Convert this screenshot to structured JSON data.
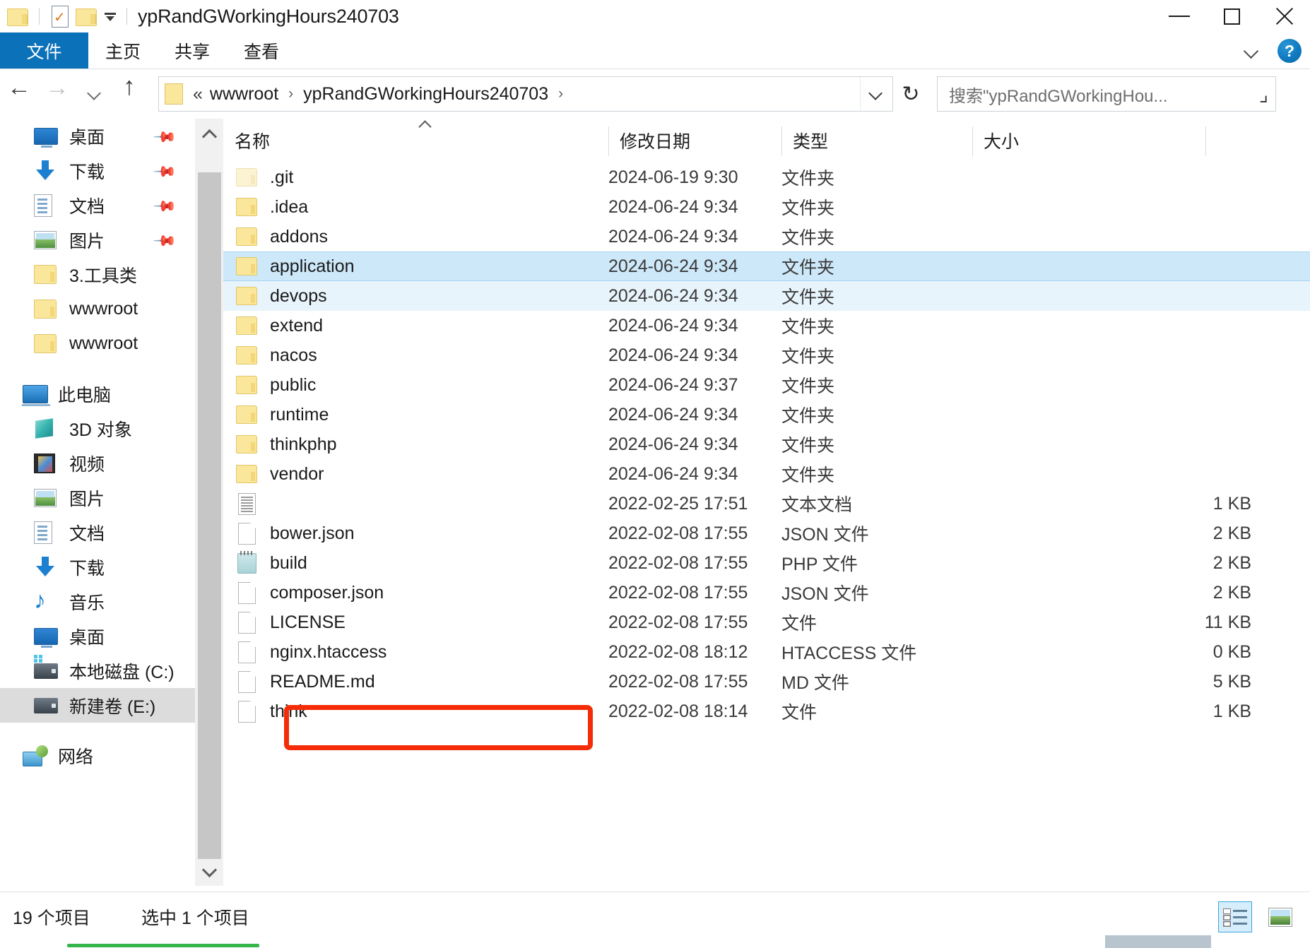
{
  "window": {
    "title": "ypRandGWorkingHours240703",
    "quick_access": [
      "folder-icon",
      "properties-icon",
      "new-folder-icon",
      "customize-dropdown-icon"
    ],
    "controls": {
      "minimize": "minimize-icon",
      "maximize": "maximize-icon",
      "close": "close-icon"
    }
  },
  "ribbon": {
    "tabs": [
      {
        "label": "文件",
        "active": true
      },
      {
        "label": "主页",
        "active": false
      },
      {
        "label": "共享",
        "active": false
      },
      {
        "label": "查看",
        "active": false
      }
    ],
    "collapse_icon": "chevron-down-icon",
    "help_label": "?",
    "accent_color": "#0b71b9"
  },
  "navbar": {
    "back_icon": "arrow-left-icon",
    "forward_icon": "arrow-right-icon",
    "recent_icon": "chevron-down-icon",
    "up_icon": "arrow-up-icon",
    "breadcrumb": {
      "folder_icon": "folder-icon",
      "overflow": "«",
      "items": [
        "wwwroot",
        "ypRandGWorkingHours240703"
      ],
      "separator": "›",
      "dropdown_icon": "chevron-down-icon"
    },
    "refresh_label": "↻",
    "search": {
      "placeholder": "搜索\"ypRandGWorkingHou...",
      "value": "",
      "icon": "search-icon"
    }
  },
  "sidebar": {
    "quick_access": [
      {
        "label": "桌面",
        "icon": "desktop-icon",
        "pinned": true
      },
      {
        "label": "下载",
        "icon": "download-icon",
        "pinned": true
      },
      {
        "label": "文档",
        "icon": "documents-icon",
        "pinned": true
      },
      {
        "label": "图片",
        "icon": "pictures-icon",
        "pinned": true
      },
      {
        "label": "3.工具类",
        "icon": "folder-icon",
        "pinned": false
      },
      {
        "label": "wwwroot",
        "icon": "folder-icon",
        "pinned": false
      },
      {
        "label": "wwwroot",
        "icon": "folder-icon",
        "pinned": false
      }
    ],
    "this_pc": {
      "label": "此电脑",
      "icon": "this-pc-icon"
    },
    "this_pc_children": [
      {
        "label": "3D 对象",
        "icon": "3d-objects-icon",
        "selected": false
      },
      {
        "label": "视频",
        "icon": "videos-icon",
        "selected": false
      },
      {
        "label": "图片",
        "icon": "pictures-icon",
        "selected": false
      },
      {
        "label": "文档",
        "icon": "documents-icon",
        "selected": false
      },
      {
        "label": "下载",
        "icon": "download-icon",
        "selected": false
      },
      {
        "label": "音乐",
        "icon": "music-icon",
        "selected": false
      },
      {
        "label": "桌面",
        "icon": "desktop-icon",
        "selected": false
      },
      {
        "label": "本地磁盘 (C:)",
        "icon": "local-disk-icon",
        "selected": false
      },
      {
        "label": "新建卷 (E:)",
        "icon": "drive-icon",
        "selected": true
      }
    ],
    "network": {
      "label": "网络",
      "icon": "network-icon"
    },
    "scrollbar": {
      "up_icon": "chevron-up-icon",
      "down_icon": "chevron-down-icon"
    }
  },
  "filelist": {
    "columns": [
      {
        "key": "name",
        "label": "名称",
        "sorted": true,
        "sort_icon": "sort-ascending-caret"
      },
      {
        "key": "date",
        "label": "修改日期"
      },
      {
        "key": "type",
        "label": "类型"
      },
      {
        "key": "size",
        "label": "大小"
      }
    ],
    "rows": [
      {
        "name": ".git",
        "date": "2024-06-19 9:30",
        "type": "文件夹",
        "size": "",
        "icon": "folder-icon-dim",
        "state": ""
      },
      {
        "name": ".idea",
        "date": "2024-06-24 9:34",
        "type": "文件夹",
        "size": "",
        "icon": "folder-icon",
        "state": ""
      },
      {
        "name": "addons",
        "date": "2024-06-24 9:34",
        "type": "文件夹",
        "size": "",
        "icon": "folder-icon",
        "state": ""
      },
      {
        "name": "application",
        "date": "2024-06-24 9:34",
        "type": "文件夹",
        "size": "",
        "icon": "folder-icon",
        "state": "selected"
      },
      {
        "name": "devops",
        "date": "2024-06-24 9:34",
        "type": "文件夹",
        "size": "",
        "icon": "folder-icon",
        "state": "hover"
      },
      {
        "name": "extend",
        "date": "2024-06-24 9:34",
        "type": "文件夹",
        "size": "",
        "icon": "folder-icon",
        "state": ""
      },
      {
        "name": "nacos",
        "date": "2024-06-24 9:34",
        "type": "文件夹",
        "size": "",
        "icon": "folder-icon",
        "state": ""
      },
      {
        "name": "public",
        "date": "2024-06-24 9:37",
        "type": "文件夹",
        "size": "",
        "icon": "folder-icon",
        "state": ""
      },
      {
        "name": "runtime",
        "date": "2024-06-24 9:34",
        "type": "文件夹",
        "size": "",
        "icon": "folder-icon",
        "state": ""
      },
      {
        "name": "thinkphp",
        "date": "2024-06-24 9:34",
        "type": "文件夹",
        "size": "",
        "icon": "folder-icon",
        "state": ""
      },
      {
        "name": "vendor",
        "date": "2024-06-24 9:34",
        "type": "文件夹",
        "size": "",
        "icon": "folder-icon",
        "state": ""
      },
      {
        "name": "",
        "date": "2022-02-25 17:51",
        "type": "文本文档",
        "size": "1 KB",
        "icon": "text-document-icon",
        "state": ""
      },
      {
        "name": "bower.json",
        "date": "2022-02-08 17:55",
        "type": "JSON 文件",
        "size": "2 KB",
        "icon": "generic-file-icon",
        "state": ""
      },
      {
        "name": "build",
        "date": "2022-02-08 17:55",
        "type": "PHP 文件",
        "size": "2 KB",
        "icon": "php-file-icon",
        "state": ""
      },
      {
        "name": "composer.json",
        "date": "2022-02-08 17:55",
        "type": "JSON 文件",
        "size": "2 KB",
        "icon": "generic-file-icon",
        "state": ""
      },
      {
        "name": "LICENSE",
        "date": "2022-02-08 17:55",
        "type": "文件",
        "size": "11 KB",
        "icon": "generic-file-icon",
        "state": ""
      },
      {
        "name": "nginx.htaccess",
        "date": "2022-02-08 18:12",
        "type": "HTACCESS 文件",
        "size": "0 KB",
        "icon": "generic-file-icon",
        "state": ""
      },
      {
        "name": "README.md",
        "date": "2022-02-08 17:55",
        "type": "MD 文件",
        "size": "5 KB",
        "icon": "generic-file-icon",
        "state": ""
      },
      {
        "name": "think",
        "date": "2022-02-08 18:14",
        "type": "文件",
        "size": "1 KB",
        "icon": "generic-file-icon",
        "state": "annotated"
      }
    ],
    "annotation": {
      "target": "think",
      "color": "#f42c07",
      "shape": "rounded-rectangle"
    }
  },
  "statusbar": {
    "item_count": "19 个项目",
    "selection": "选中 1 个项目",
    "progress_color": "#35b54a",
    "views": [
      {
        "name": "details-view",
        "icon": "details-view-icon",
        "active": true
      },
      {
        "name": "large-icons-view",
        "icon": "large-icons-view-icon",
        "active": false
      }
    ]
  }
}
